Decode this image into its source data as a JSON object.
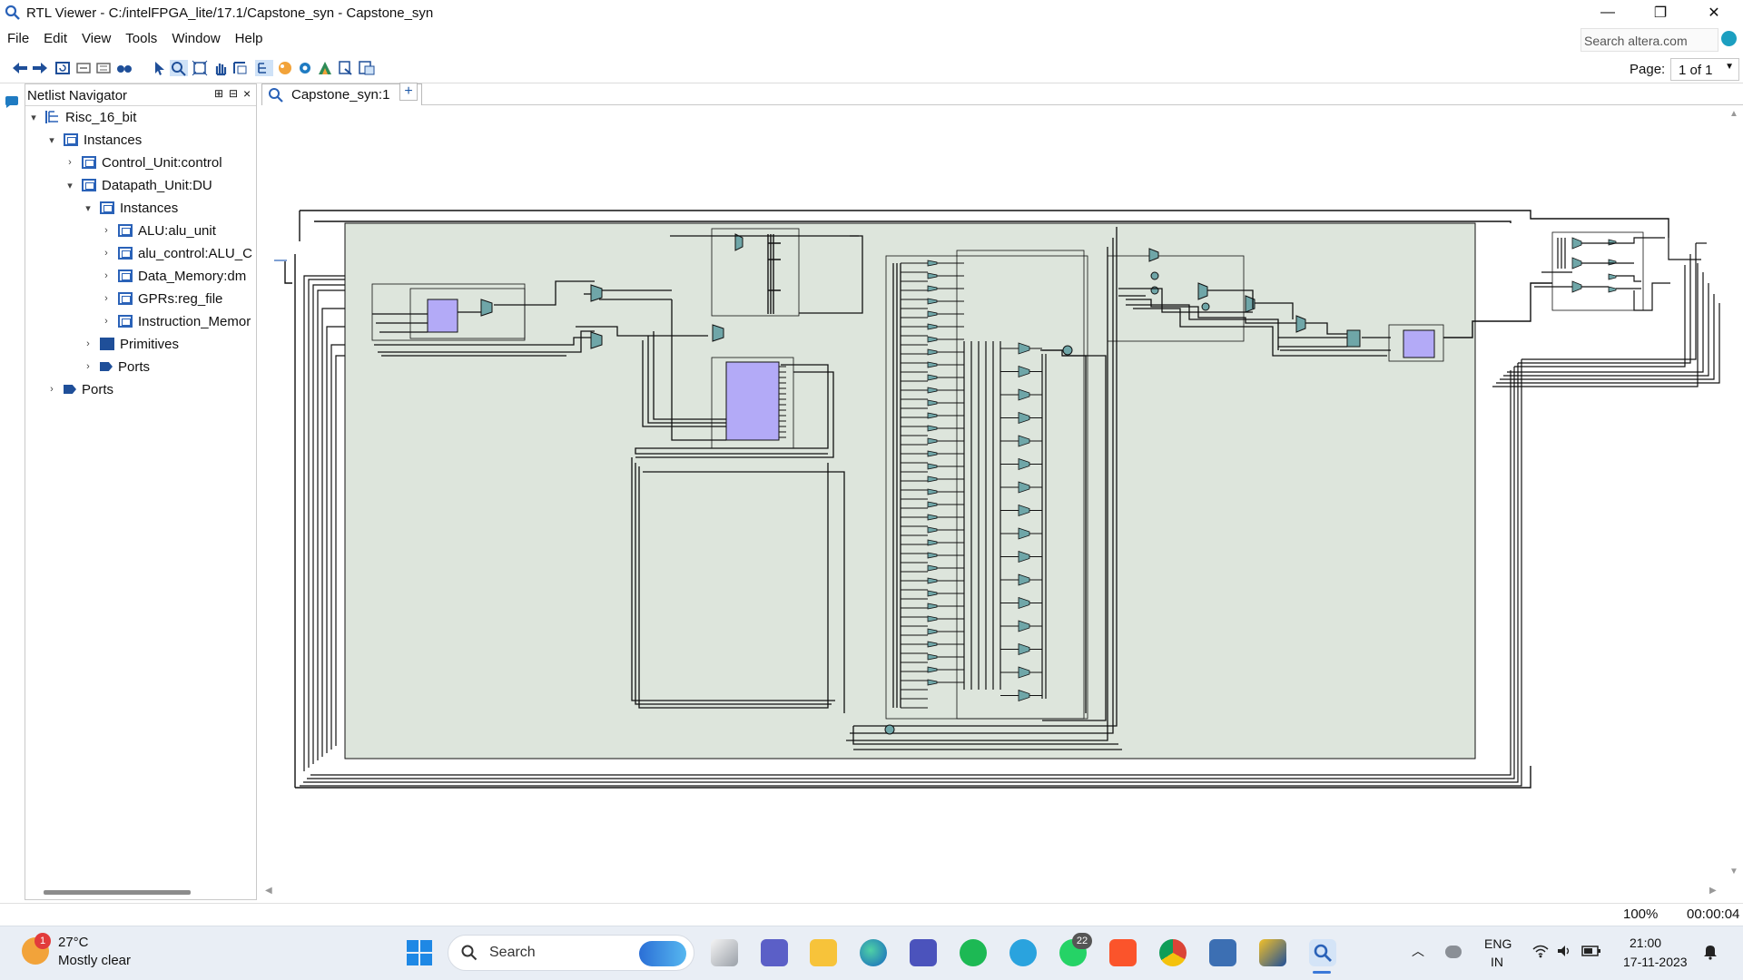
{
  "window": {
    "title": "RTL Viewer - C:/intelFPGA_lite/17.1/Capstone_syn - Capstone_syn",
    "minimize_glyph": "—",
    "restore_glyph": "❐",
    "close_glyph": "✕"
  },
  "menu": [
    "File",
    "Edit",
    "View",
    "Tools",
    "Window",
    "Help"
  ],
  "web_search": {
    "placeholder": "Search altera.com"
  },
  "toolbar": {
    "icons": [
      "back-icon",
      "forward-icon",
      "refresh-icon",
      "collapse-icon",
      "expand-icon",
      "find-icon",
      "select-icon",
      "zoom-icon",
      "fit-icon",
      "hand-icon",
      "rect-zoom-icon",
      "hierarchy-icon",
      "net-icon",
      "settings-icon",
      "netlist-icon",
      "export-icon",
      "filter-icon"
    ],
    "page_label": "Page:",
    "page_value": "1 of 1"
  },
  "navigator": {
    "title": "Netlist Navigator",
    "header_controls": [
      "⊞",
      "⊟",
      "×"
    ],
    "tree": [
      {
        "label": "Risc_16_bit",
        "depth": 0,
        "expanded": true,
        "icon": "root-hierarchy-icon"
      },
      {
        "label": "Instances",
        "depth": 1,
        "expanded": true,
        "icon": "instance-icon"
      },
      {
        "label": "Control_Unit:control",
        "depth": 2,
        "expanded": false,
        "icon": "instance-icon"
      },
      {
        "label": "Datapath_Unit:DU",
        "depth": 2,
        "expanded": true,
        "icon": "instance-icon"
      },
      {
        "label": "Instances",
        "depth": 3,
        "expanded": true,
        "icon": "instance-icon"
      },
      {
        "label": "ALU:alu_unit",
        "depth": 4,
        "expanded": false,
        "icon": "instance-icon"
      },
      {
        "label": "alu_control:ALU_C",
        "depth": 4,
        "expanded": false,
        "icon": "instance-icon"
      },
      {
        "label": "Data_Memory:dm",
        "depth": 4,
        "expanded": false,
        "icon": "instance-icon"
      },
      {
        "label": "GPRs:reg_file",
        "depth": 4,
        "expanded": false,
        "icon": "instance-icon"
      },
      {
        "label": "Instruction_Memor",
        "depth": 4,
        "expanded": false,
        "icon": "instance-icon"
      },
      {
        "label": "Primitives",
        "depth": 3,
        "expanded": false,
        "icon": "primitives-icon"
      },
      {
        "label": "Ports",
        "depth": 3,
        "expanded": false,
        "icon": "port-icon"
      },
      {
        "label": "Ports",
        "depth": 1,
        "expanded": false,
        "icon": "port-icon"
      }
    ]
  },
  "tabs": [
    {
      "label": "Capstone_syn:1",
      "icon": "rtl-viewer-icon"
    }
  ],
  "add_tab_glyph": "+",
  "status": {
    "zoom": "100%",
    "elapsed": "00:00:04"
  },
  "taskbar": {
    "weather": {
      "temp": "27°C",
      "desc": "Mostly clear",
      "badge": "1"
    },
    "search_label": "Search",
    "apps": [
      "task-view-icon",
      "teams-meet-icon",
      "file-explorer-icon",
      "edge-icon",
      "teams-icon",
      "spotify-icon",
      "telegram-icon",
      "whatsapp-icon",
      "brave-icon",
      "chrome-icon",
      "virtualbox-icon",
      "quartus-icon",
      "rtl-viewer-icon"
    ],
    "whatsapp_badge": "22",
    "tray": {
      "lang": "ENG",
      "region": "IN",
      "time": "21:00",
      "date": "17-11-2023"
    }
  },
  "colors": {
    "schematic_bg": "#dde5dc",
    "block_fill": "#b3aaf7",
    "mux_fill": "#6fa6a8",
    "wire": "#111111",
    "accent": "#2a62b8"
  }
}
